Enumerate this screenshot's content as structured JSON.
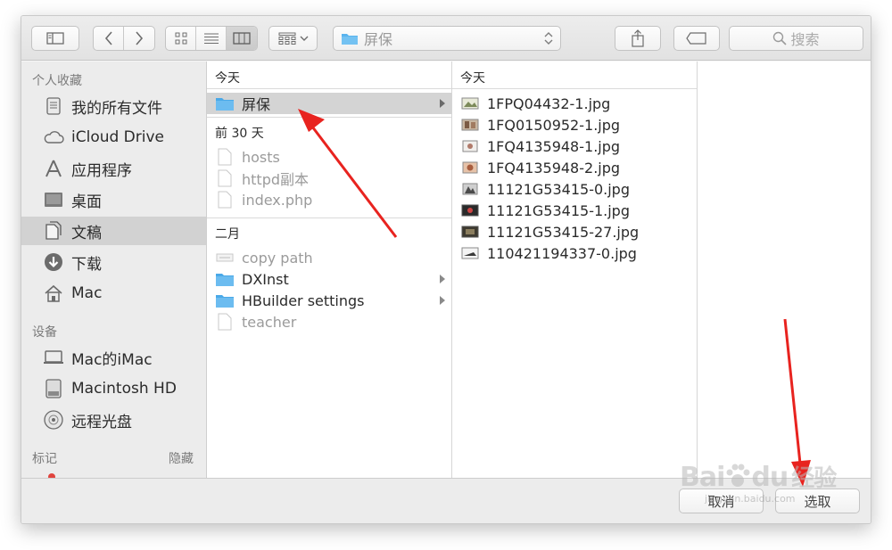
{
  "toolbar": {
    "path_label": "屏保",
    "search_placeholder": "搜索",
    "view_modes": [
      "icon-view",
      "list-view",
      "column-view"
    ],
    "active_view": "column-view"
  },
  "sidebar": {
    "favorites_header": "个人收藏",
    "favorites": [
      {
        "label": "我的所有文件",
        "icon": "all-files-icon"
      },
      {
        "label": "iCloud Drive",
        "icon": "cloud-icon"
      },
      {
        "label": "应用程序",
        "icon": "applications-icon"
      },
      {
        "label": "桌面",
        "icon": "desktop-icon"
      },
      {
        "label": "文稿",
        "icon": "documents-icon",
        "selected": true
      },
      {
        "label": "下载",
        "icon": "download-icon"
      },
      {
        "label": "Mac",
        "icon": "home-icon"
      }
    ],
    "devices_header": "设备",
    "devices": [
      {
        "label": "Mac的iMac",
        "icon": "computer-icon"
      },
      {
        "label": "Macintosh HD",
        "icon": "disk-icon"
      },
      {
        "label": "远程光盘",
        "icon": "optical-disc-icon"
      }
    ],
    "tags_header": "标记",
    "tags_hide": "隐藏"
  },
  "column1": {
    "groups": [
      {
        "title": "今天",
        "items": [
          {
            "name": "屏保",
            "type": "folder",
            "selected": true,
            "has_children": true
          }
        ]
      },
      {
        "title": "前 30 天",
        "items": [
          {
            "name": "hosts",
            "type": "file",
            "dim": true
          },
          {
            "name": "httpd副本",
            "type": "file",
            "dim": true
          },
          {
            "name": "index.php",
            "type": "file",
            "dim": true
          }
        ]
      },
      {
        "title": "二月",
        "items": [
          {
            "name": "copy path",
            "type": "file",
            "dim": true
          },
          {
            "name": "DXInst",
            "type": "folder",
            "has_children": true
          },
          {
            "name": "HBuilder settings",
            "type": "folder",
            "has_children": true
          },
          {
            "name": "teacher",
            "type": "file",
            "dim": true
          }
        ]
      }
    ]
  },
  "column2": {
    "group_title": "今天",
    "files": [
      "1FPQ04432-1.jpg",
      "1FQ0150952-1.jpg",
      "1FQ4135948-1.jpg",
      "1FQ4135948-2.jpg",
      "11121G53415-0.jpg",
      "11121G53415-1.jpg",
      "11121G53415-27.jpg",
      "110421194337-0.jpg"
    ]
  },
  "bottom": {
    "cancel_label": "取消",
    "choose_label": "选取"
  },
  "watermark": {
    "brand": "Bai",
    "brand2": "du",
    "cn": "经验",
    "url": "jingyan.baidu.com"
  },
  "colors": {
    "annotation_arrow": "#e8231f",
    "folder": "#5ab4ee"
  }
}
